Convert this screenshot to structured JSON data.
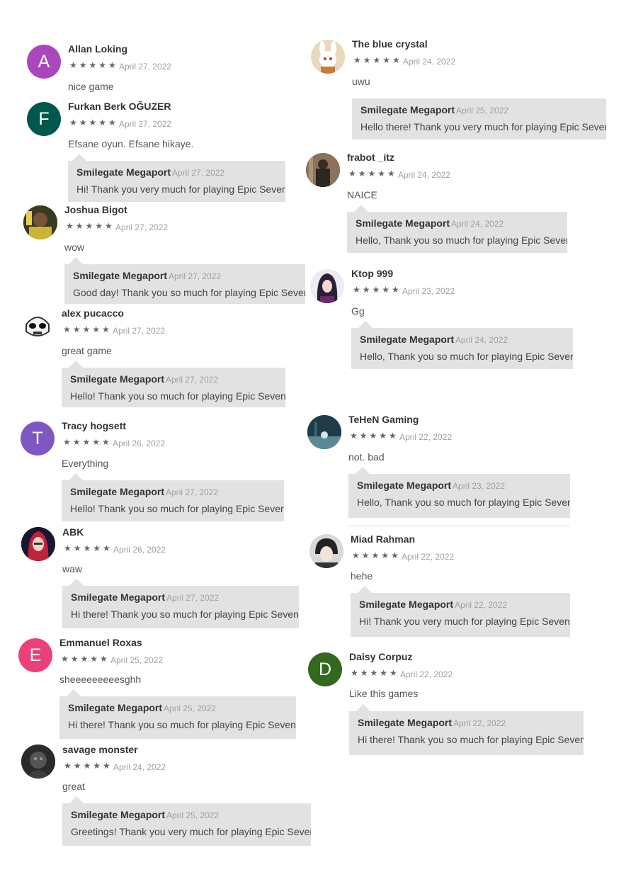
{
  "reviews": [
    {
      "name": "Allan Loking",
      "stars": "★★★★★",
      "date": "April 27, 2022",
      "text": "nice game",
      "avatar_letter": "A",
      "avatar_color": "#ab47bc",
      "avatar_icon": "letter-avatar"
    },
    {
      "name": "Furkan Berk OĞUZER",
      "stars": "★★★★★",
      "date": "April 27, 2022",
      "text": "Efsane oyun. Efsane hikaye.",
      "avatar_letter": "F",
      "avatar_color": "#00574b",
      "avatar_icon": "letter-avatar",
      "reply": {
        "author": "Smilegate Megaport",
        "date": "April 27, 2022",
        "text": "Hi! Thank you very much for playing Epic Seven!"
      }
    },
    {
      "name": "Joshua Bigot",
      "stars": "★★★★★",
      "date": "April 27, 2022",
      "text": "wow",
      "avatar_icon": "photo-avatar",
      "reply": {
        "author": "Smilegate Megaport",
        "date": "April 27, 2022",
        "text": "Good day! Thank you so much for playing Epic Seven!"
      }
    },
    {
      "name": "alex pucacco",
      "stars": "★★★★★",
      "date": "April 27, 2022",
      "text": "great game",
      "avatar_icon": "stormtrooper-avatar",
      "reply": {
        "author": "Smilegate Megaport",
        "date": "April 27, 2022",
        "text": "Hello! Thank you so much for playing Epic Seven! W"
      }
    },
    {
      "name": "Tracy hogsett",
      "stars": "★★★★★",
      "date": "April 26, 2022",
      "text": "Everything",
      "avatar_letter": "T",
      "avatar_color": "#7e57c2",
      "avatar_icon": "letter-avatar",
      "reply": {
        "author": "Smilegate Megaport",
        "date": "April 27, 2022",
        "text": "Hello! Thank you so much for playing Epic Seven!"
      }
    },
    {
      "name": "ABK",
      "stars": "★★★★★",
      "date": "April 26, 2022",
      "text": "waw",
      "avatar_icon": "anime-avatar",
      "reply": {
        "author": "Smilegate Megaport",
        "date": "April 27, 2022",
        "text": "Hi there! Thank you so much for playing Epic Seven! W"
      }
    },
    {
      "name": "Emmanuel Roxas",
      "stars": "★★★★★",
      "date": "April 25, 2022",
      "text": "sheeeeeeeeesghh",
      "avatar_letter": "E",
      "avatar_color": "#ec407a",
      "avatar_icon": "letter-avatar",
      "reply": {
        "author": "Smilegate Megaport",
        "date": "April 25, 2022",
        "text": "Hi there! Thank you so much for playing Epic Seven! W"
      }
    },
    {
      "name": "savage monster",
      "stars": "★★★★★",
      "date": "April 24, 2022",
      "text": "great",
      "avatar_icon": "dark-avatar",
      "reply": {
        "author": "Smilegate Megaport",
        "date": "April 25, 2022",
        "text": "Greetings! Thank you very much for playing Epic Seven!"
      }
    },
    {
      "name": "The blue crystal",
      "stars": "★★★★★",
      "date": "April 24, 2022",
      "text": "uwu",
      "avatar_icon": "bunny-avatar",
      "reply": {
        "author": "Smilegate Megaport",
        "date": "April 25, 2022",
        "text": "Hello there! Thank you very much for playing Epic Seven!"
      }
    },
    {
      "name": "frabot _itz",
      "stars": "★★★★★",
      "date": "April 24, 2022",
      "text": "NAICE",
      "avatar_icon": "figure-avatar",
      "reply": {
        "author": "Smilegate Megaport",
        "date": "April 24, 2022",
        "text": "Hello, Thank you so much for playing Epic Seven!"
      }
    },
    {
      "name": "Ktop 999",
      "stars": "★★★★★",
      "date": "April 23, 2022",
      "text": "Gg",
      "avatar_icon": "anime-avatar",
      "reply": {
        "author": "Smilegate Megaport",
        "date": "April 24, 2022",
        "text": "Hello, Thank you so much for playing Epic Seven!"
      }
    },
    {
      "name": "TeHeN Gaming",
      "stars": "★★★★★",
      "date": "April 22, 2022",
      "text": "not. bad",
      "avatar_icon": "scene-avatar",
      "reply": {
        "author": "Smilegate Megaport",
        "date": "April 23, 2022",
        "text": "Hello, Thank you so much for playing Epic Seven!"
      }
    },
    {
      "name": "Miad Rahman",
      "stars": "★★★★★",
      "date": "April 22, 2022",
      "text": "hehe",
      "avatar_icon": "manga-avatar",
      "reply": {
        "author": "Smilegate Megaport",
        "date": "April 22, 2022",
        "text": "Hi! Thank you very much for playing Epic Seven! W"
      }
    },
    {
      "name": "Daisy Corpuz",
      "stars": "★★★★★",
      "date": "April 22, 2022",
      "text": "Like this games",
      "avatar_letter": "D",
      "avatar_color": "#33691e",
      "avatar_icon": "letter-avatar",
      "reply": {
        "author": "Smilegate Megaport",
        "date": "April 22, 2022",
        "text": "Hi there! Thank you so much for playing Epic Seven!"
      }
    }
  ]
}
